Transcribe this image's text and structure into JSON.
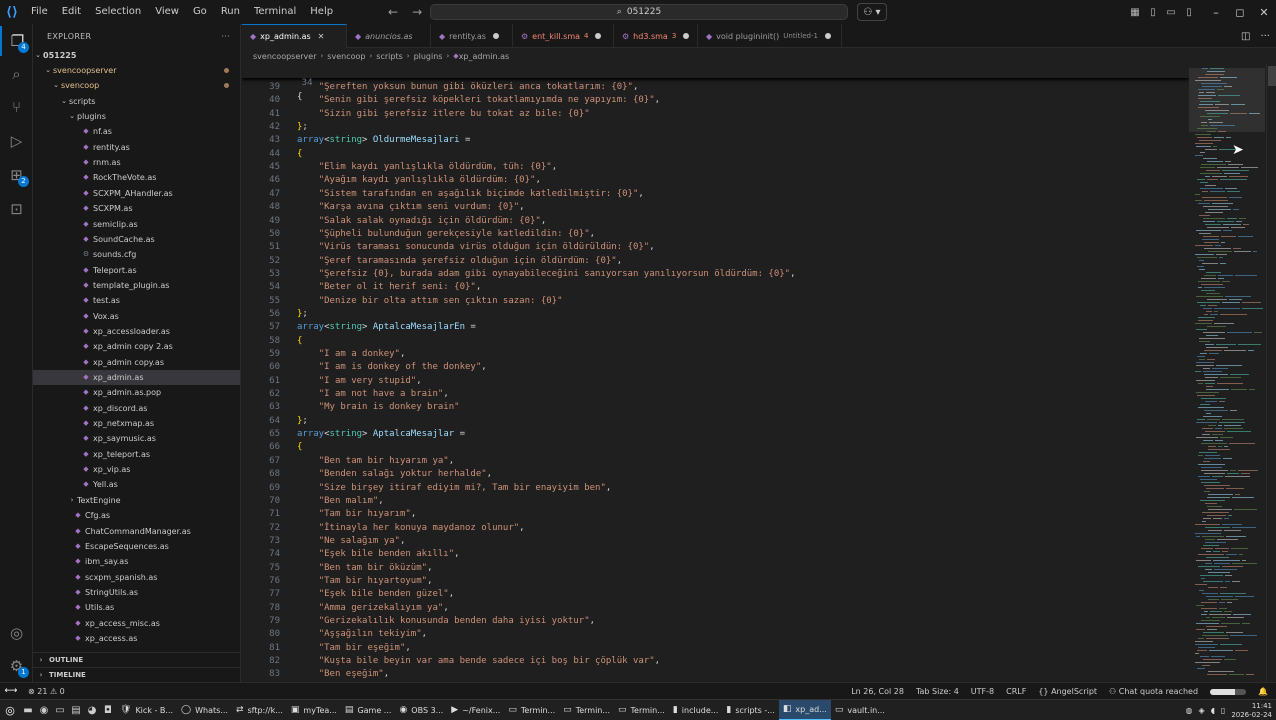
{
  "titlebar": {
    "menu": [
      "File",
      "Edit",
      "Selection",
      "View",
      "Go",
      "Run",
      "Terminal",
      "Help"
    ],
    "search": "051225"
  },
  "activity": {
    "explorer_badge": "4",
    "extensions_badge": "2",
    "settings_badge": "1"
  },
  "sidebar": {
    "title": "EXPLORER",
    "workspace": "051225",
    "rows": [
      {
        "label": "svencoopserver",
        "depth": 1,
        "kind": "folder",
        "open": true,
        "modified": true
      },
      {
        "label": "svencoop",
        "depth": 2,
        "kind": "folder",
        "open": true,
        "modified": true
      },
      {
        "label": "scripts",
        "depth": 3,
        "kind": "folder",
        "open": true
      },
      {
        "label": "plugins",
        "depth": 4,
        "kind": "folder",
        "open": true
      },
      {
        "label": "nf.as",
        "depth": 5,
        "kind": "file"
      },
      {
        "label": "rentity.as",
        "depth": 5,
        "kind": "file"
      },
      {
        "label": "rnm.as",
        "depth": 5,
        "kind": "file"
      },
      {
        "label": "RockTheVote.as",
        "depth": 5,
        "kind": "file"
      },
      {
        "label": "SCXPM_AHandler.as",
        "depth": 5,
        "kind": "file"
      },
      {
        "label": "SCXPM.as",
        "depth": 5,
        "kind": "file"
      },
      {
        "label": "semiclip.as",
        "depth": 5,
        "kind": "file"
      },
      {
        "label": "SoundCache.as",
        "depth": 5,
        "kind": "file"
      },
      {
        "label": "sounds.cfg",
        "depth": 5,
        "kind": "cfg"
      },
      {
        "label": "Teleport.as",
        "depth": 5,
        "kind": "file"
      },
      {
        "label": "template_plugin.as",
        "depth": 5,
        "kind": "file"
      },
      {
        "label": "test.as",
        "depth": 5,
        "kind": "file"
      },
      {
        "label": "Vox.as",
        "depth": 5,
        "kind": "file"
      },
      {
        "label": "xp_accessloader.as",
        "depth": 5,
        "kind": "file"
      },
      {
        "label": "xp_admin copy 2.as",
        "depth": 5,
        "kind": "file"
      },
      {
        "label": "xp_admin copy.as",
        "depth": 5,
        "kind": "file"
      },
      {
        "label": "xp_admin.as",
        "depth": 5,
        "kind": "file",
        "selected": true
      },
      {
        "label": "xp_admin.as.pop",
        "depth": 5,
        "kind": "file"
      },
      {
        "label": "xp_discord.as",
        "depth": 5,
        "kind": "file"
      },
      {
        "label": "xp_netxmap.as",
        "depth": 5,
        "kind": "file"
      },
      {
        "label": "xp_saymusic.as",
        "depth": 5,
        "kind": "file"
      },
      {
        "label": "xp_teleport.as",
        "depth": 5,
        "kind": "file"
      },
      {
        "label": "xp_vip.as",
        "depth": 5,
        "kind": "file"
      },
      {
        "label": "Yell.as",
        "depth": 5,
        "kind": "file"
      },
      {
        "label": "TextEngine",
        "depth": 4,
        "kind": "folder",
        "open": false
      },
      {
        "label": "Cfg.as",
        "depth": 4,
        "kind": "file"
      },
      {
        "label": "ChatCommandManager.as",
        "depth": 4,
        "kind": "file"
      },
      {
        "label": "EscapeSequences.as",
        "depth": 4,
        "kind": "file"
      },
      {
        "label": "ibm_say.as",
        "depth": 4,
        "kind": "file"
      },
      {
        "label": "scxpm_spanish.as",
        "depth": 4,
        "kind": "file"
      },
      {
        "label": "StringUtils.as",
        "depth": 4,
        "kind": "file"
      },
      {
        "label": "Utils.as",
        "depth": 4,
        "kind": "file"
      },
      {
        "label": "xp_access_misc.as",
        "depth": 4,
        "kind": "file"
      },
      {
        "label": "xp_access.as",
        "depth": 4,
        "kind": "file"
      }
    ],
    "outline": "OUTLINE",
    "timeline": "TIMELINE"
  },
  "tabs": [
    {
      "label": "xp_admin.as",
      "state": "active"
    },
    {
      "label": "anuncios.as",
      "state": "italic"
    },
    {
      "label": "rentity.as",
      "state": "dirty"
    },
    {
      "label": "ent_kill.sma",
      "state": "error",
      "count": "4"
    },
    {
      "label": "hd3.sma",
      "state": "error",
      "count": "3"
    },
    {
      "label": "void plugininit()",
      "suffix": "Untitled-1",
      "state": "dirty"
    }
  ],
  "breadcrumb": [
    "svencoopserver",
    "svencoop",
    "scripts",
    "plugins",
    "xp_admin.as"
  ],
  "sticky_line": "34",
  "code": [
    {
      "n": "39",
      "t": "    \"Şereften yoksun bunun gibi öküzleri anca tokatlarım: {0}\","
    },
    {
      "n": "40",
      "t": "    \"Senin gibi şerefsiz köpekleri tokatlamıyımda ne yapıyım: {0}\","
    },
    {
      "n": "41",
      "t": "    \"Sizin gibi şerefsiz itlere bu tokat az bile: {0}\""
    },
    {
      "n": "42",
      "t": "};"
    },
    {
      "n": "43",
      "t": "array<string> OldurmeMesajlari ="
    },
    {
      "n": "44",
      "t": "{"
    },
    {
      "n": "45",
      "t": "    \"Elim kaydı yanlışlıkla öldürdüm, tüh: {0}\","
    },
    {
      "n": "46",
      "t": "    \"Ayağım kaydı yanlışlıkla öldürdüm: {0}\","
    },
    {
      "n": "47",
      "t": "    \"Sistem tarafından en aşağılık biçimde katledilmiştir: {0}\","
    },
    {
      "n": "48",
      "t": "    \"Karşa avına çıktım seni vurdum: {0}\","
    },
    {
      "n": "49",
      "t": "    \"Salak salak oynadığı için öldürdüm: {0}\","
    },
    {
      "n": "50",
      "t": "    \"Şüpheli bulunduğun gerekçesiyle katledildin: {0}\","
    },
    {
      "n": "51",
      "t": "    \"Virüs taraması sonucunda virüs olduğun için öldürüldün: {0}\","
    },
    {
      "n": "52",
      "t": "    \"Şeref taramasında şerefsiz olduğun için öldürdüm: {0}\","
    },
    {
      "n": "53",
      "t": "    \"Şerefsiz {0}, burada adam gibi oynayabileceğini sanıyorsan yanılıyorsun öldürdüm: {0}\","
    },
    {
      "n": "54",
      "t": "    \"Beter ol it herif seni: {0}\","
    },
    {
      "n": "55",
      "t": "    \"Denize bir olta attım sen çıktın sazan: {0}\""
    },
    {
      "n": "56",
      "t": "};"
    },
    {
      "n": "57",
      "t": "array<string> AptalcaMesajlarEn ="
    },
    {
      "n": "58",
      "t": "{"
    },
    {
      "n": "59",
      "t": "    \"I am a donkey\","
    },
    {
      "n": "60",
      "t": "    \"I am is donkey of the donkey\","
    },
    {
      "n": "61",
      "t": "    \"I am very stupid\","
    },
    {
      "n": "62",
      "t": "    \"I am not have a brain\","
    },
    {
      "n": "63",
      "t": "    \"My brain is donkey brain\""
    },
    {
      "n": "64",
      "t": "};"
    },
    {
      "n": "65",
      "t": "array<string> AptalcaMesajlar ="
    },
    {
      "n": "66",
      "t": "{"
    },
    {
      "n": "67",
      "t": "    \"Ben tam bir hıyarım ya\","
    },
    {
      "n": "68",
      "t": "    \"Benden salağı yoktur herhalde\","
    },
    {
      "n": "69",
      "t": "    \"Size birşey itiraf ediyim mi?, Tam bir enayiyim ben\","
    },
    {
      "n": "70",
      "t": "    \"Ben malım\","
    },
    {
      "n": "71",
      "t": "    \"Tam bir hıyarım\","
    },
    {
      "n": "72",
      "t": "    \"İtinayla her konuya maydanoz olunur\","
    },
    {
      "n": "73",
      "t": "    \"Ne salağım ya\","
    },
    {
      "n": "74",
      "t": "    \"Eşek bile benden akıllı\","
    },
    {
      "n": "75",
      "t": "    \"Ben tam bir öküzüm\","
    },
    {
      "n": "76",
      "t": "    \"Tam bir hıyartoyum\","
    },
    {
      "n": "77",
      "t": "    \"Eşek bile benden güzel\","
    },
    {
      "n": "78",
      "t": "    \"Amma gerizekalıyım ya\","
    },
    {
      "n": "79",
      "t": "    \"Gerizekalılık konusunda benden daha iyisi yoktur\","
    },
    {
      "n": "80",
      "t": "    \"Aşşağılın tekiyim\","
    },
    {
      "n": "81",
      "t": "    \"Tam bir eşeğim\","
    },
    {
      "n": "82",
      "t": "    \"Kuşta bile beyin var ama bende sadece içi boş bir çöplük var\","
    },
    {
      "n": "83",
      "t": "    \"Ben eşeğim\","
    }
  ],
  "status": {
    "problems": "⊗ 21 ⚠ 0",
    "position": "Ln 26, Col 28",
    "tab_size": "Tab Size: 4",
    "encoding": "UTF-8",
    "eol": "CRLF",
    "language": "AngelScript",
    "chat": "Chat quota reached",
    "progress": 0.7
  },
  "taskbar": {
    "apps": [
      {
        "label": "Kick - B...",
        "icon": "🛡"
      },
      {
        "label": "Whats...",
        "icon": "◯"
      },
      {
        "label": "sftp://k...",
        "icon": "⇄"
      },
      {
        "label": "myTea...",
        "icon": "▣"
      },
      {
        "label": "Game ...",
        "icon": "▤"
      },
      {
        "label": "OBS 3...",
        "icon": "◉"
      },
      {
        "label": "~/Fenix...",
        "icon": "▶"
      },
      {
        "label": "Termin...",
        "icon": "▭"
      },
      {
        "label": "Termin...",
        "icon": "▭"
      },
      {
        "label": "Termin...",
        "icon": "▭"
      },
      {
        "label": "include...",
        "icon": "▮"
      },
      {
        "label": "scripts -...",
        "icon": "▮"
      },
      {
        "label": "xp_ad...",
        "icon": "◧",
        "active": true
      },
      {
        "label": "vault.in...",
        "icon": "▭"
      }
    ],
    "time": "11:41",
    "date": "2026-02-24"
  },
  "colors": {
    "accent": "#0078d4",
    "string": "#ce9178",
    "keyword": "#569cd6",
    "type": "#4ec9b0"
  }
}
